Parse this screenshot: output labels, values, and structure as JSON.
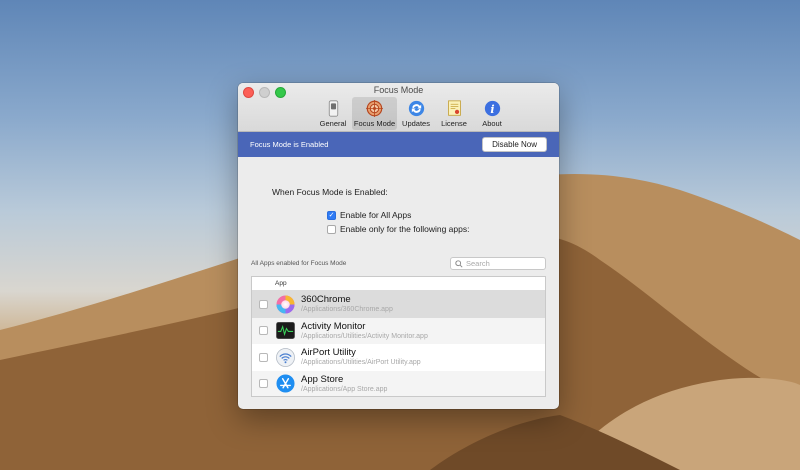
{
  "window": {
    "title": "Focus Mode"
  },
  "toolbar": {
    "tabs": [
      {
        "label": "General",
        "icon": "switch-icon"
      },
      {
        "label": "Focus Mode",
        "icon": "target-icon",
        "active": true
      },
      {
        "label": "Updates",
        "icon": "refresh-icon"
      },
      {
        "label": "License",
        "icon": "certificate-icon"
      },
      {
        "label": "About",
        "icon": "info-icon"
      }
    ]
  },
  "banner": {
    "status": "Focus Mode is Enabled",
    "button_label": "Disable Now",
    "color": "#4a66b8"
  },
  "settings": {
    "heading": "When Focus Mode is Enabled:",
    "options": [
      {
        "label": "Enable for All Apps",
        "checked": true
      },
      {
        "label": "Enable only for the following apps:",
        "checked": false
      }
    ]
  },
  "list": {
    "caption": "All Apps enabled for Focus Mode",
    "search_placeholder": "Search",
    "column_header": "App",
    "apps": [
      {
        "name": "360Chrome",
        "path": "/Applications/360Chrome.app",
        "icon": "360chrome-icon",
        "checked": false
      },
      {
        "name": "Activity Monitor",
        "path": "/Applications/Utilities/Activity Monitor.app",
        "icon": "activity-monitor-icon",
        "checked": false
      },
      {
        "name": "AirPort Utility",
        "path": "/Applications/Utilities/AirPort Utility.app",
        "icon": "airport-utility-icon",
        "checked": false
      },
      {
        "name": "App Store",
        "path": "/Applications/App Store.app",
        "icon": "app-store-icon",
        "checked": false
      }
    ]
  }
}
